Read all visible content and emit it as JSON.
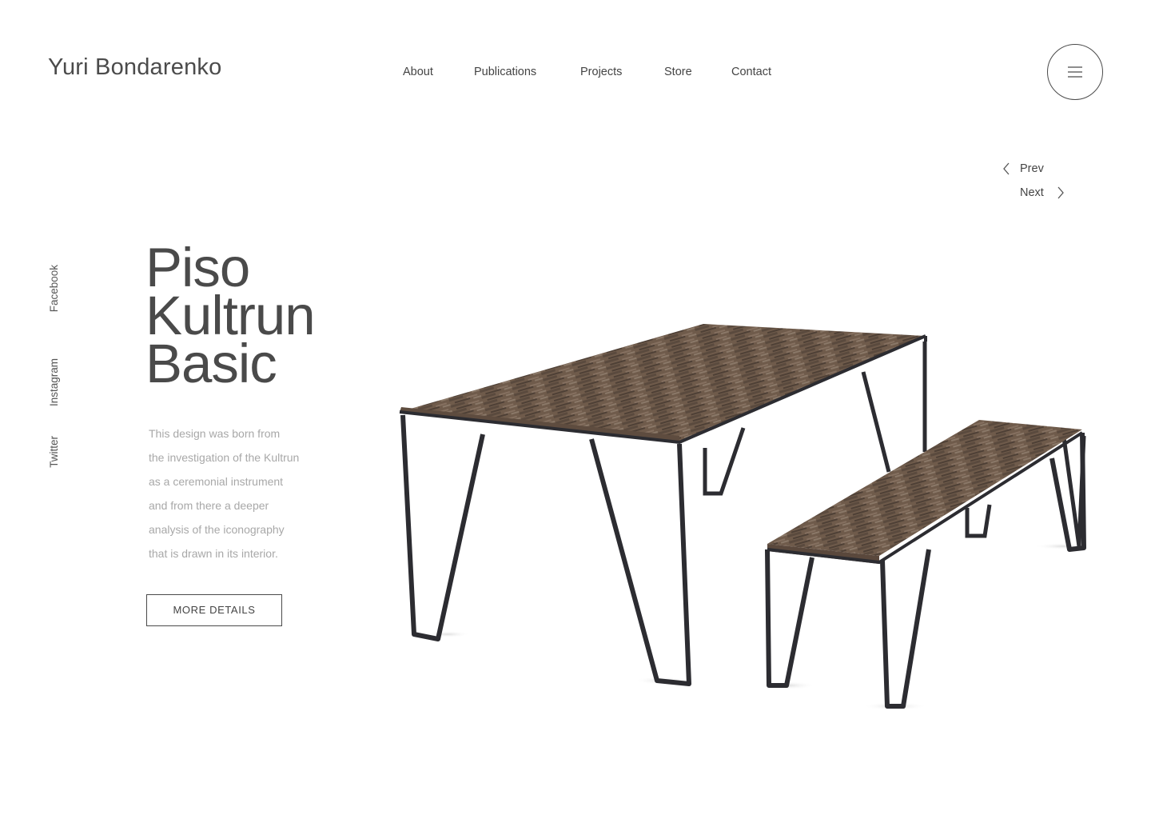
{
  "header": {
    "logo": "Yuri Bondarenko",
    "nav": [
      "About",
      "Publications",
      "Projects",
      "Store",
      "Contact"
    ],
    "menu_icon": "hamburger-icon"
  },
  "pager": {
    "prev_label": "Prev",
    "next_label": "Next"
  },
  "social": [
    "Facebook",
    "Instagram",
    "Twitter"
  ],
  "hero": {
    "title_lines": [
      "Piso",
      "Kultrun",
      "Basic"
    ],
    "description_lines": [
      "This design was born from",
      "the investigation of the Kultrun",
      "as a ceremonial instrument",
      "and from there a deeper",
      "analysis of the iconography",
      "that is drawn in its interior."
    ],
    "cta": "MORE DETAILS"
  },
  "colors": {
    "text": "#4a4a4a",
    "muted": "#a8a8a8",
    "wood": "#6e5a4a",
    "metal": "#2b2b30"
  }
}
